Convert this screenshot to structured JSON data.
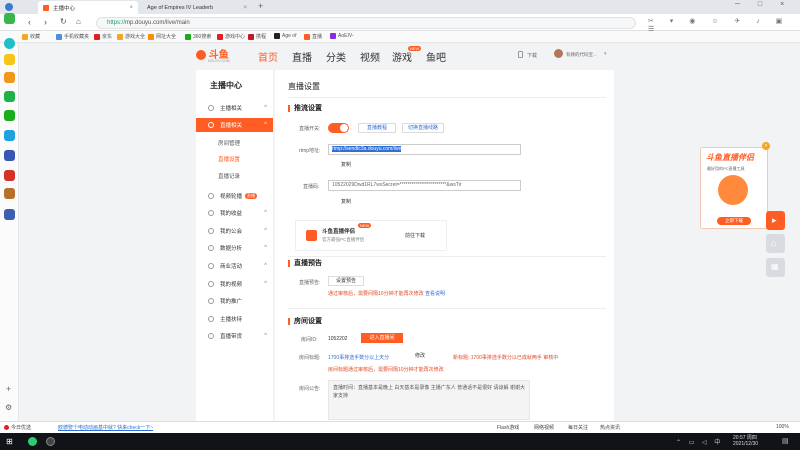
{
  "browser": {
    "tabs": [
      {
        "title": "主播中心",
        "active": true
      },
      {
        "title": "Age of Empires IV Leaderb",
        "active": false
      }
    ],
    "url_scheme": "https://",
    "url_rest": "mp.douyu.com/live/main",
    "bookmarks": [
      "收藏",
      "手机收藏夹",
      "京东",
      "游戏大全",
      "网址大全",
      "360搜索",
      "游戏中心",
      "携程",
      "Age of",
      "直播",
      "AoEIV-"
    ],
    "bookmark_colors": [
      "#f5a623",
      "#4a90e2",
      "#e02020",
      "#f5a623",
      "#ff8c00",
      "#1aad19",
      "#e02020",
      "#c01d2a",
      "#222222",
      "#ff5d23",
      "#8a2be2"
    ]
  },
  "site": {
    "logo_text": "斗鱼",
    "logo_sub": "DOUYU.COM",
    "nav": [
      "首页",
      "直播",
      "分类",
      "视频",
      "游戏",
      "鱼吧"
    ],
    "nav_active": 0,
    "game_badge": "NEW",
    "download": "下载",
    "username": "有顾的代码宝..."
  },
  "sidebar": {
    "title": "主播中心",
    "items": [
      {
        "label": "主播相关",
        "active": false,
        "caret": "^"
      },
      {
        "label": "直播相关",
        "active": true,
        "caret": "^"
      },
      {
        "label": "视频轮播",
        "active": false,
        "caret": "",
        "badge": "直播"
      },
      {
        "label": "我的收益",
        "active": false,
        "caret": "^"
      },
      {
        "label": "我的公会",
        "active": false,
        "caret": "^"
      },
      {
        "label": "数据分析",
        "active": false,
        "caret": "^"
      },
      {
        "label": "商业活动",
        "active": false,
        "caret": "^"
      },
      {
        "label": "我的视频",
        "active": false,
        "caret": "^"
      },
      {
        "label": "我的推广",
        "active": false,
        "caret": ""
      },
      {
        "label": "主播扶持",
        "active": false,
        "caret": ""
      },
      {
        "label": "直播带货",
        "active": false,
        "caret": "^"
      }
    ],
    "subitems": [
      {
        "label": "房间管理",
        "active": false
      },
      {
        "label": "直播设置",
        "active": true
      },
      {
        "label": "直播记录",
        "active": false
      }
    ]
  },
  "main": {
    "title": "直播设置",
    "push": {
      "section": "推流设置",
      "switch_label": "直播开关:",
      "tutorial": "直播教程",
      "record": "切换直播线路",
      "rtmp_label": "rtmp地址:",
      "rtmp_value": "rtmp://sendtc3a.douyu.com/live",
      "copy1": "复制",
      "code_label": "直播码:",
      "code_value": "10522029Dwd1RL7wsSecret=************************&wsTir",
      "copy2": "复制",
      "promo_title": "斗鱼直播伴侣",
      "promo_new": "NEW",
      "promo_sub": "官方最强PC直播伴侣",
      "promo_btn": "前往下载"
    },
    "preview": {
      "section": "直播预告",
      "label": "直播预告:",
      "btn": "设置预告",
      "warn": "通过审核后，需要间隔10分钟才能再次修改",
      "warn_link": "查看说明"
    },
    "room": {
      "section": "房间设置",
      "id_label": "房间ID:",
      "id_value": "1052202",
      "id_btn": "进入直播间",
      "title_label": "房间标题:",
      "title_value": "1700事排选手数分以上天分",
      "title_edit": "修改",
      "new_title_label": "新标题:",
      "new_title_value": "1700事排选手数分以已成就两手",
      "review": "审核中",
      "title_warn": "房间标题通过审核后，需要间隔10分钟才能再次修改",
      "notice_label": "房间公告:",
      "notice_text": "直播时间：直播基本是晚上 白天基本是录像 主播广东人 普通话不是很好 请谅解 谢谢大家支持"
    }
  },
  "float": {
    "title": "斗鱼直播伴侣",
    "sub": "最好用的PC直播工具",
    "btn": "立即下载"
  },
  "statusbar": {
    "left": "今日优选",
    "news": "欧德娶个电动动画基中就? 快来check一下~",
    "items": [
      "Flash游戏",
      "网络视频",
      "每日关注",
      "热点资讯"
    ],
    "zoom": "100%"
  },
  "taskbar": {
    "time": "20:57 周四",
    "date": "2021/12/30"
  },
  "colors": {
    "accent": "#ff5d23",
    "link": "#2f6fd6",
    "warn": "#e34a24"
  }
}
